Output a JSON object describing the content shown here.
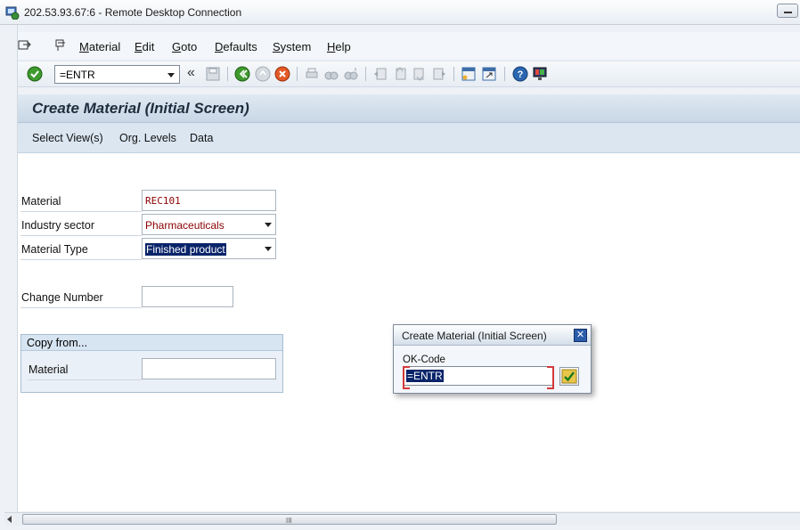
{
  "rdp": {
    "title": "202.53.93.67:6 - Remote Desktop Connection"
  },
  "menu": {
    "items": [
      {
        "pre": "",
        "u": "M",
        "post": "aterial"
      },
      {
        "pre": "",
        "u": "E",
        "post": "dit"
      },
      {
        "pre": "",
        "u": "G",
        "post": "oto"
      },
      {
        "pre": "",
        "u": "D",
        "post": "efaults"
      },
      {
        "pre": "",
        "u": "S",
        "post": "ystem"
      },
      {
        "pre": "",
        "u": "H",
        "post": "elp"
      }
    ]
  },
  "toolbar": {
    "command_field": "=ENTR",
    "back_arrows": "«"
  },
  "screen": {
    "title": "Create Material (Initial Screen)",
    "app_buttons": [
      "Select View(s)",
      "Org. Levels",
      "Data"
    ]
  },
  "form": {
    "material_label": "Material",
    "material_value": "REC101",
    "industry_label": "Industry sector",
    "industry_value": "Pharmaceuticals",
    "type_label": "Material Type",
    "type_value": "Finished product",
    "change_label": "Change Number",
    "change_value": "",
    "copy_from": {
      "heading": "Copy from...",
      "material_label": "Material",
      "material_value": ""
    }
  },
  "dialog": {
    "title": "Create Material (Initial Screen)",
    "close": "✕",
    "field_label": "OK-Code",
    "field_value": "=ENTR"
  },
  "scrollbar": {
    "grip": "III"
  },
  "colors": {
    "accent": "#0a246a",
    "required_text": "#8b0000",
    "title_bg": "#c8d7e6"
  }
}
